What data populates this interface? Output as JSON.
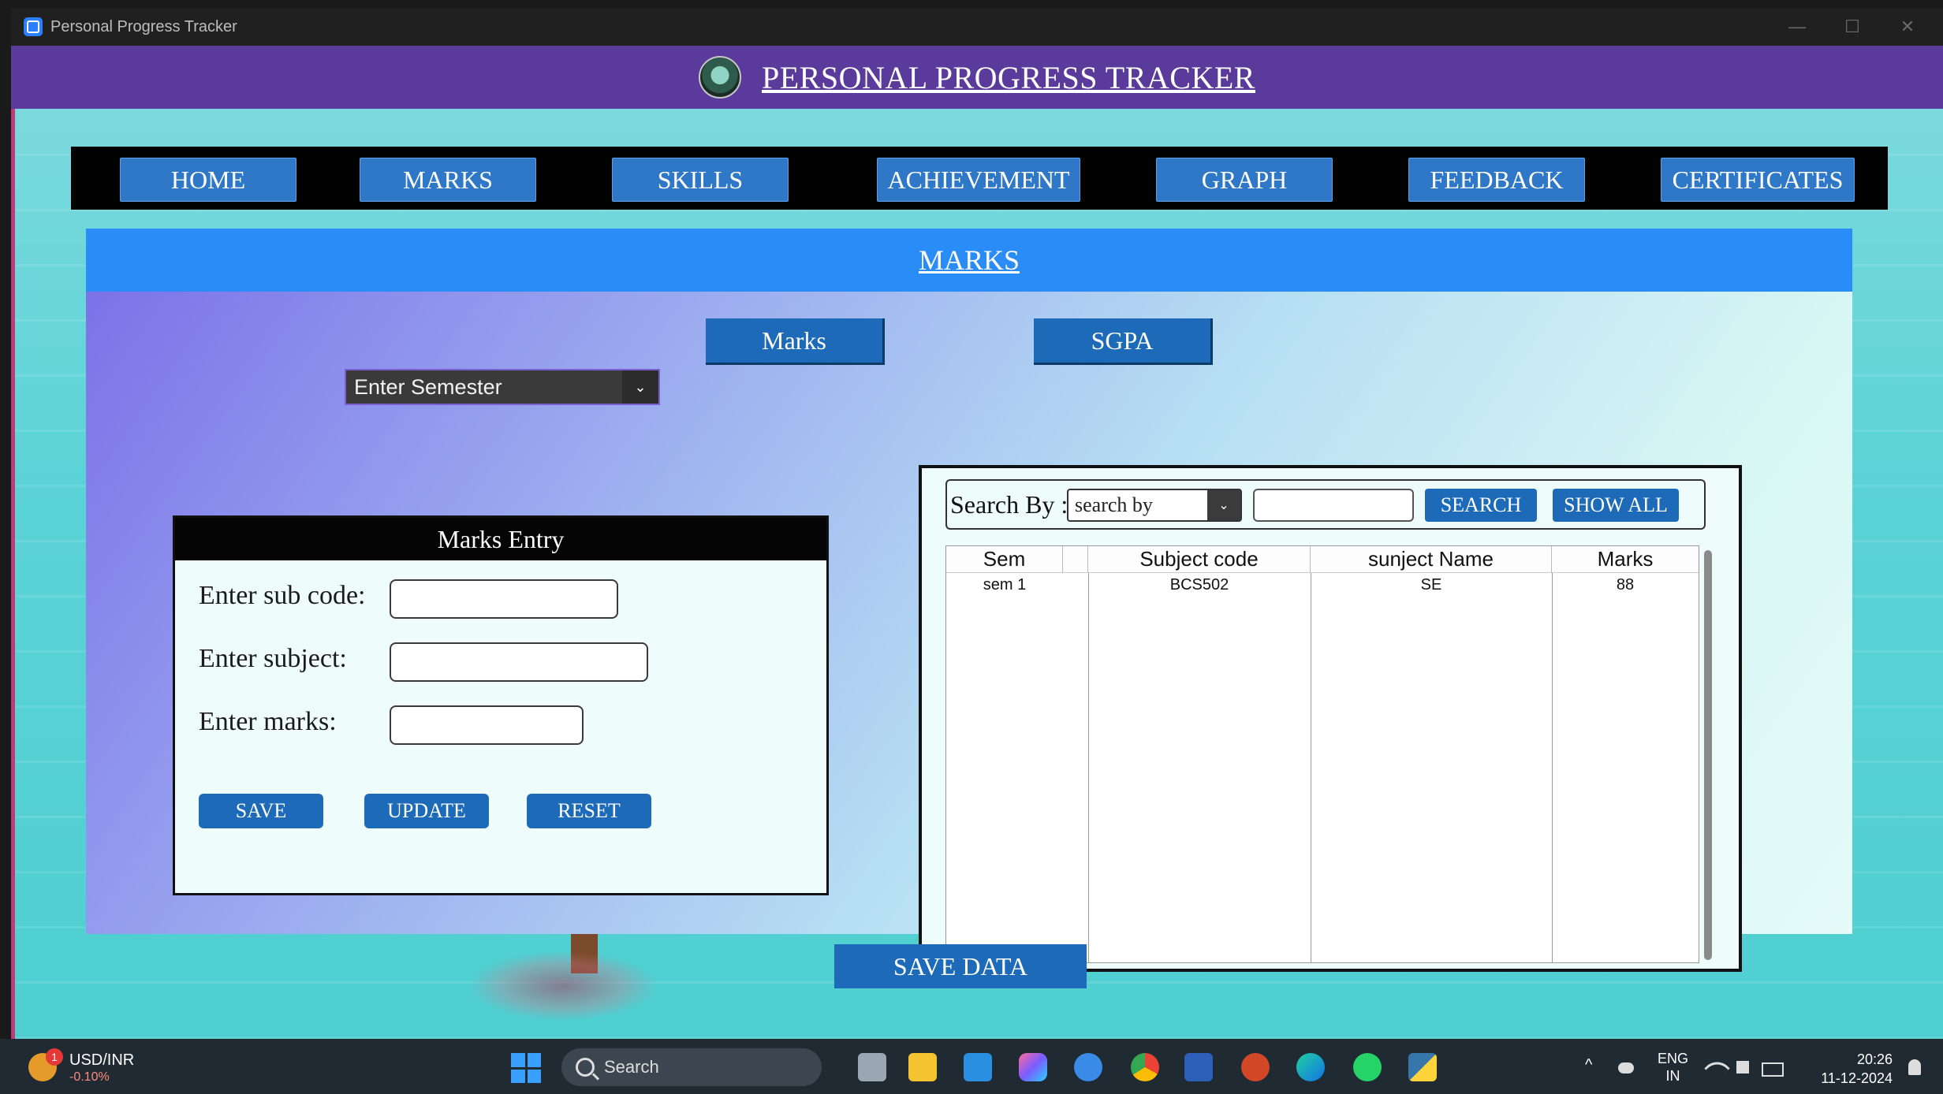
{
  "window": {
    "title": "Personal Progress Tracker",
    "controls": [
      "—",
      "☐",
      "✕"
    ]
  },
  "header": {
    "title": "PERSONAL PROGRESS TRACKER"
  },
  "nav": [
    "HOME",
    "MARKS",
    "SKILLS",
    "ACHIEVEMENT",
    "GRAPH",
    "FEEDBACK",
    "CERTIFICATES"
  ],
  "page": {
    "title": "MARKS",
    "tabs": [
      "Marks",
      "SGPA"
    ],
    "semester_select": {
      "value": "Enter Semester",
      "arrow": "⌄"
    }
  },
  "entry": {
    "title": "Marks Entry",
    "fields": [
      {
        "label": "Enter sub code:",
        "value": ""
      },
      {
        "label": "Enter subject:",
        "value": ""
      },
      {
        "label": "Enter marks:",
        "value": ""
      }
    ],
    "buttons": [
      "SAVE",
      "UPDATE",
      "RESET"
    ]
  },
  "search": {
    "label": "Search By :",
    "by_value": "search by",
    "arrow": "⌄",
    "input_value": "",
    "buttons": [
      "SEARCH",
      "SHOW ALL"
    ]
  },
  "table": {
    "columns": [
      "Sem",
      "Subject code",
      "sunject Name",
      "Marks"
    ],
    "rows": [
      [
        "sem 1",
        "BCS502",
        "SE",
        "88"
      ]
    ]
  },
  "save_data_label": "SAVE DATA",
  "taskbar": {
    "ticker": {
      "label": "USD/INR",
      "change": "-0.10%",
      "badge": "1"
    },
    "search_label": "Search",
    "lang_line1": "ENG",
    "lang_line2": "IN",
    "time": "20:26",
    "date": "11-12-2024",
    "tray_chevron": "^"
  },
  "colors": {
    "header": "#5a3a9a",
    "button": "#1d6bb8",
    "panel_header": "#2a8cf6"
  }
}
